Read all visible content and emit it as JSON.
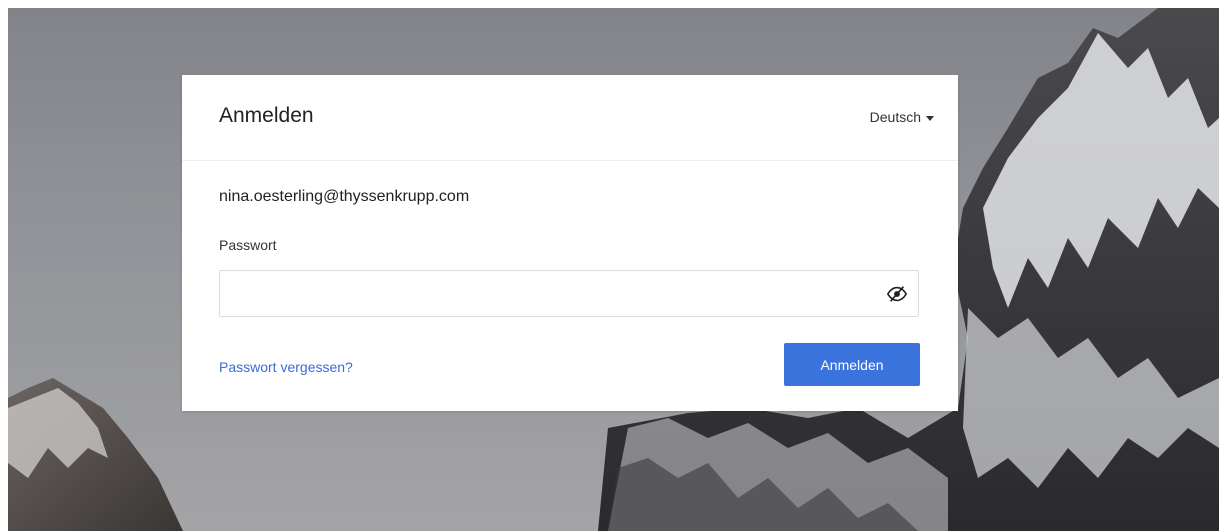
{
  "header": {
    "title": "Anmelden",
    "language": "Deutsch"
  },
  "account": {
    "email": "nina.oesterling@thyssenkrupp.com"
  },
  "password": {
    "label": "Passwort",
    "value": "",
    "toggle_icon": "eye-slash-icon"
  },
  "actions": {
    "forgot_label": "Passwort vergessen?",
    "submit_label": "Anmelden"
  },
  "colors": {
    "primary": "#3b73dd",
    "link": "#3a6bd6",
    "background_sky": "#8f9196"
  },
  "icons": {
    "language_caret": "caret-down-icon"
  }
}
